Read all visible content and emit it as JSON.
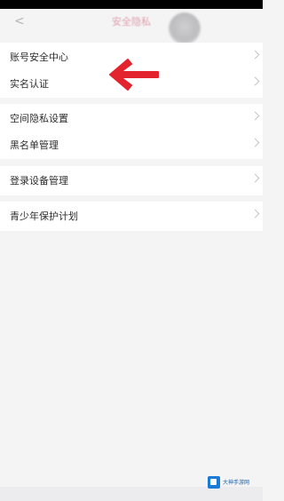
{
  "header": {
    "back_label": "<",
    "title": "安全隐私"
  },
  "sections": [
    {
      "items": [
        {
          "label": "账号安全中心"
        },
        {
          "label": "实名认证"
        }
      ]
    },
    {
      "items": [
        {
          "label": "空间隐私设置"
        },
        {
          "label": "黑名单管理"
        }
      ]
    },
    {
      "items": [
        {
          "label": "登录设备管理"
        }
      ]
    },
    {
      "items": [
        {
          "label": "青少年保护计划"
        }
      ]
    }
  ],
  "annotation": {
    "color": "#e3232e",
    "icon": "left-arrow-icon"
  },
  "watermark": {
    "text": "大神手游网"
  },
  "colors": {
    "background": "#f4f4f5",
    "row_background": "#ffffff",
    "title_tint": "#e0a0ac"
  }
}
